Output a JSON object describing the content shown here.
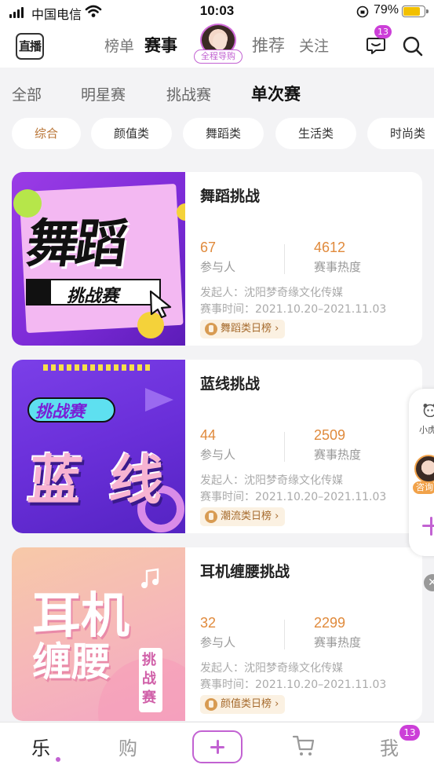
{
  "status_bar": {
    "carrier": "中国电信",
    "time": "10:03",
    "battery": "79%"
  },
  "top_nav": {
    "logo_label": "直播",
    "tabs": [
      "榜单",
      "赛事",
      "推荐",
      "关注"
    ],
    "active_tab": "赛事",
    "guide_label": "全程导购",
    "message_badge": "13"
  },
  "categories": [
    "全部",
    "明星赛",
    "挑战赛",
    "单次赛"
  ],
  "filters": [
    "综合",
    "颜值类",
    "舞蹈类",
    "生活类",
    "时尚类"
  ],
  "cards": [
    {
      "title": "舞蹈挑战",
      "participants": "67",
      "participants_label": "参与人",
      "heat": "4612",
      "heat_label": "赛事热度",
      "organizer": "发起人：沈阳梦奇缘文化传媒",
      "period": "赛事时间：2021.10.20–2021.11.03",
      "rank": "舞蹈类日榜 ›",
      "poster_main": "舞蹈",
      "poster_sub": "挑战赛"
    },
    {
      "title": "蓝线挑战",
      "participants": "44",
      "participants_label": "参与人",
      "heat": "2509",
      "heat_label": "赛事热度",
      "organizer": "发起人：沈阳梦奇缘文化传媒",
      "period": "赛事时间：2021.10.20–2021.11.03",
      "rank": "潮流类日榜 ›",
      "poster_main": "蓝 线",
      "poster_sub": "挑战赛"
    },
    {
      "title": "耳机缠腰挑战",
      "participants": "32",
      "participants_label": "参与人",
      "heat": "2299",
      "heat_label": "赛事热度",
      "organizer": "发起人：沈阳梦奇缘文化传媒",
      "period": "赛事时间：2021.10.20–2021.11.03",
      "rank": "颜值类日榜 ›",
      "poster_main_1": "耳机",
      "poster_main_2": "缠腰",
      "poster_sub": "挑战赛"
    }
  ],
  "float_widget": {
    "label_top": "小虎",
    "label_bottom": "咨询"
  },
  "tab_bar": {
    "tabs": [
      "乐",
      "购",
      "",
      "我"
    ],
    "me_badge": "13"
  }
}
